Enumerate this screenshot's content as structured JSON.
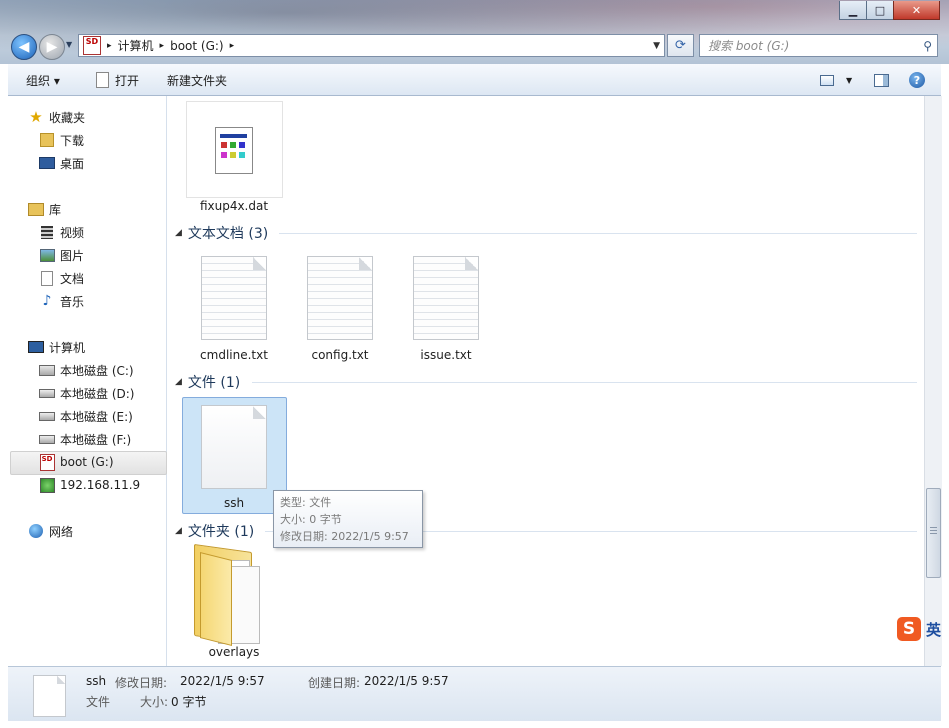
{
  "window": {
    "minimize_glyph": "▁",
    "maximize_glyph": "□",
    "close_glyph": "✕"
  },
  "address": {
    "drive_badge": "SD",
    "crumbs": [
      "计算机",
      "boot (G:)"
    ],
    "separator": "▸"
  },
  "search": {
    "placeholder": "搜索 boot (G:)"
  },
  "toolbar": {
    "organize": "组织 ▾",
    "open": "打开",
    "new_folder": "新建文件夹"
  },
  "nav": {
    "favorites": {
      "label": "收藏夹",
      "items": [
        "下载",
        "桌面"
      ]
    },
    "libraries": {
      "label": "库",
      "items": [
        "视频",
        "图片",
        "文档",
        "音乐"
      ]
    },
    "computer": {
      "label": "计算机",
      "items": [
        "本地磁盘 (C:)",
        "本地磁盘 (D:)",
        "本地磁盘 (E:)",
        "本地磁盘 (F:)",
        "boot (G:)",
        "192.168.11.9"
      ]
    },
    "network": {
      "label": "网络"
    }
  },
  "content": {
    "top_file": "fixup4x.dat",
    "groups": [
      {
        "label": "文本文档 (3)",
        "files": [
          "cmdline.txt",
          "config.txt",
          "issue.txt"
        ]
      },
      {
        "label": "文件 (1)",
        "files": [
          "ssh"
        ]
      },
      {
        "label": "文件夹 (1)",
        "files": [
          "overlays"
        ]
      }
    ]
  },
  "tooltip": {
    "type": "类型: 文件",
    "size": "大小: 0 字节",
    "modified": "修改日期: 2022/1/5 9:57"
  },
  "status": {
    "name": "ssh",
    "type": "文件",
    "modified_label": "修改日期:",
    "modified_value": "2022/1/5 9:57",
    "size_label": "大小:",
    "size_value": "0 字节",
    "created_label": "创建日期:",
    "created_value": "2022/1/5 9:57"
  },
  "ime": {
    "logo": "S",
    "mode": "英"
  },
  "colors": {
    "accent": "#1e395b",
    "selection": "#cce4f7",
    "ime_orange": "#f05a22"
  }
}
